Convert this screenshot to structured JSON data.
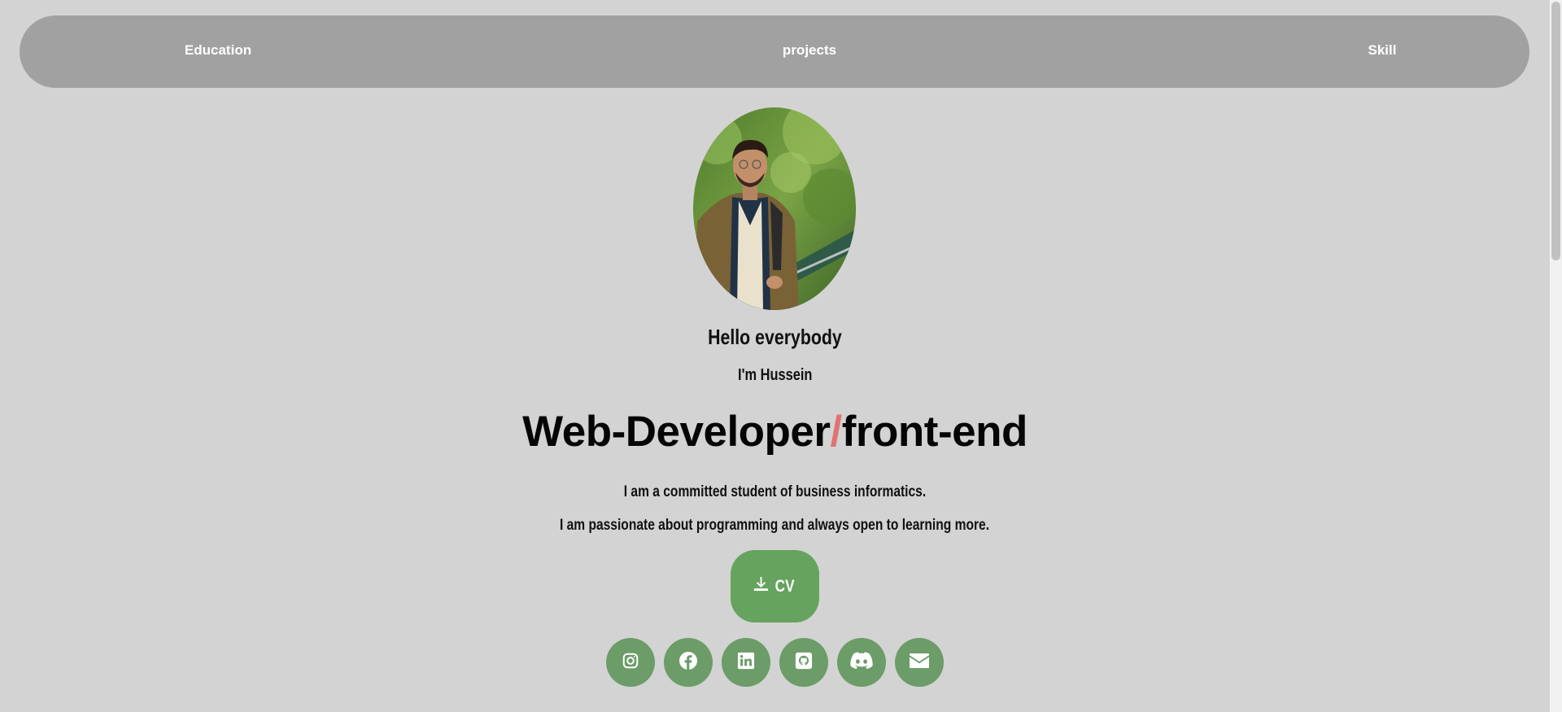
{
  "nav": {
    "education": "Education",
    "projects": "projects",
    "skill": "Skill"
  },
  "hero": {
    "greeting": "Hello everybody",
    "name": "I'm Hussein",
    "role_part1": "Web-Developer",
    "role_slash": "/",
    "role_part2": "front-end",
    "description_line1": "I am a committed student of business informatics.",
    "description_line2": "I am passionate about programming and always open to learning more."
  },
  "cv_button": {
    "label": "CV",
    "icon": "download-icon"
  },
  "social_links": [
    {
      "icon": "instagram-icon"
    },
    {
      "icon": "facebook-icon"
    },
    {
      "icon": "linkedin-icon"
    },
    {
      "icon": "github-icon"
    },
    {
      "icon": "discord-icon"
    },
    {
      "icon": "email-icon"
    }
  ],
  "colors": {
    "background": "#d3d3d3",
    "nav_background": "#a1a1a1",
    "accent_slash": "#e07373",
    "button_green": "#66a35e",
    "social_green": "#6c9c67"
  }
}
